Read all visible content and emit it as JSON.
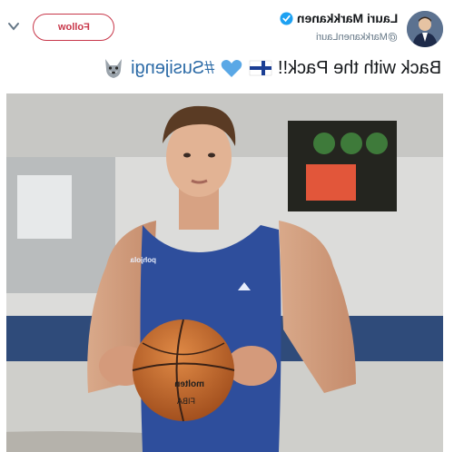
{
  "author": {
    "name": "Lauri Markkanen",
    "handle": "@MarkkanenLauri",
    "verified": true
  },
  "follow_button": {
    "label": "Follow"
  },
  "tweet": {
    "text": "Back with the Pack!!",
    "hashtag": "#Susijengi"
  },
  "photo": {
    "jersey_label": "pohjola",
    "ball_text_1": "molten",
    "ball_text_2": "FIBA"
  },
  "colors": {
    "follow_border": "#c8374a",
    "verified": "#1da1f2",
    "hashtag": "#2b6aa6",
    "jersey": "#2e4e9c",
    "ball": "#c96a2a"
  },
  "icons": [
    "chevron-down-icon",
    "verified-icon",
    "wolf-emoji",
    "finland-flag-emoji",
    "blue-heart-emoji"
  ]
}
